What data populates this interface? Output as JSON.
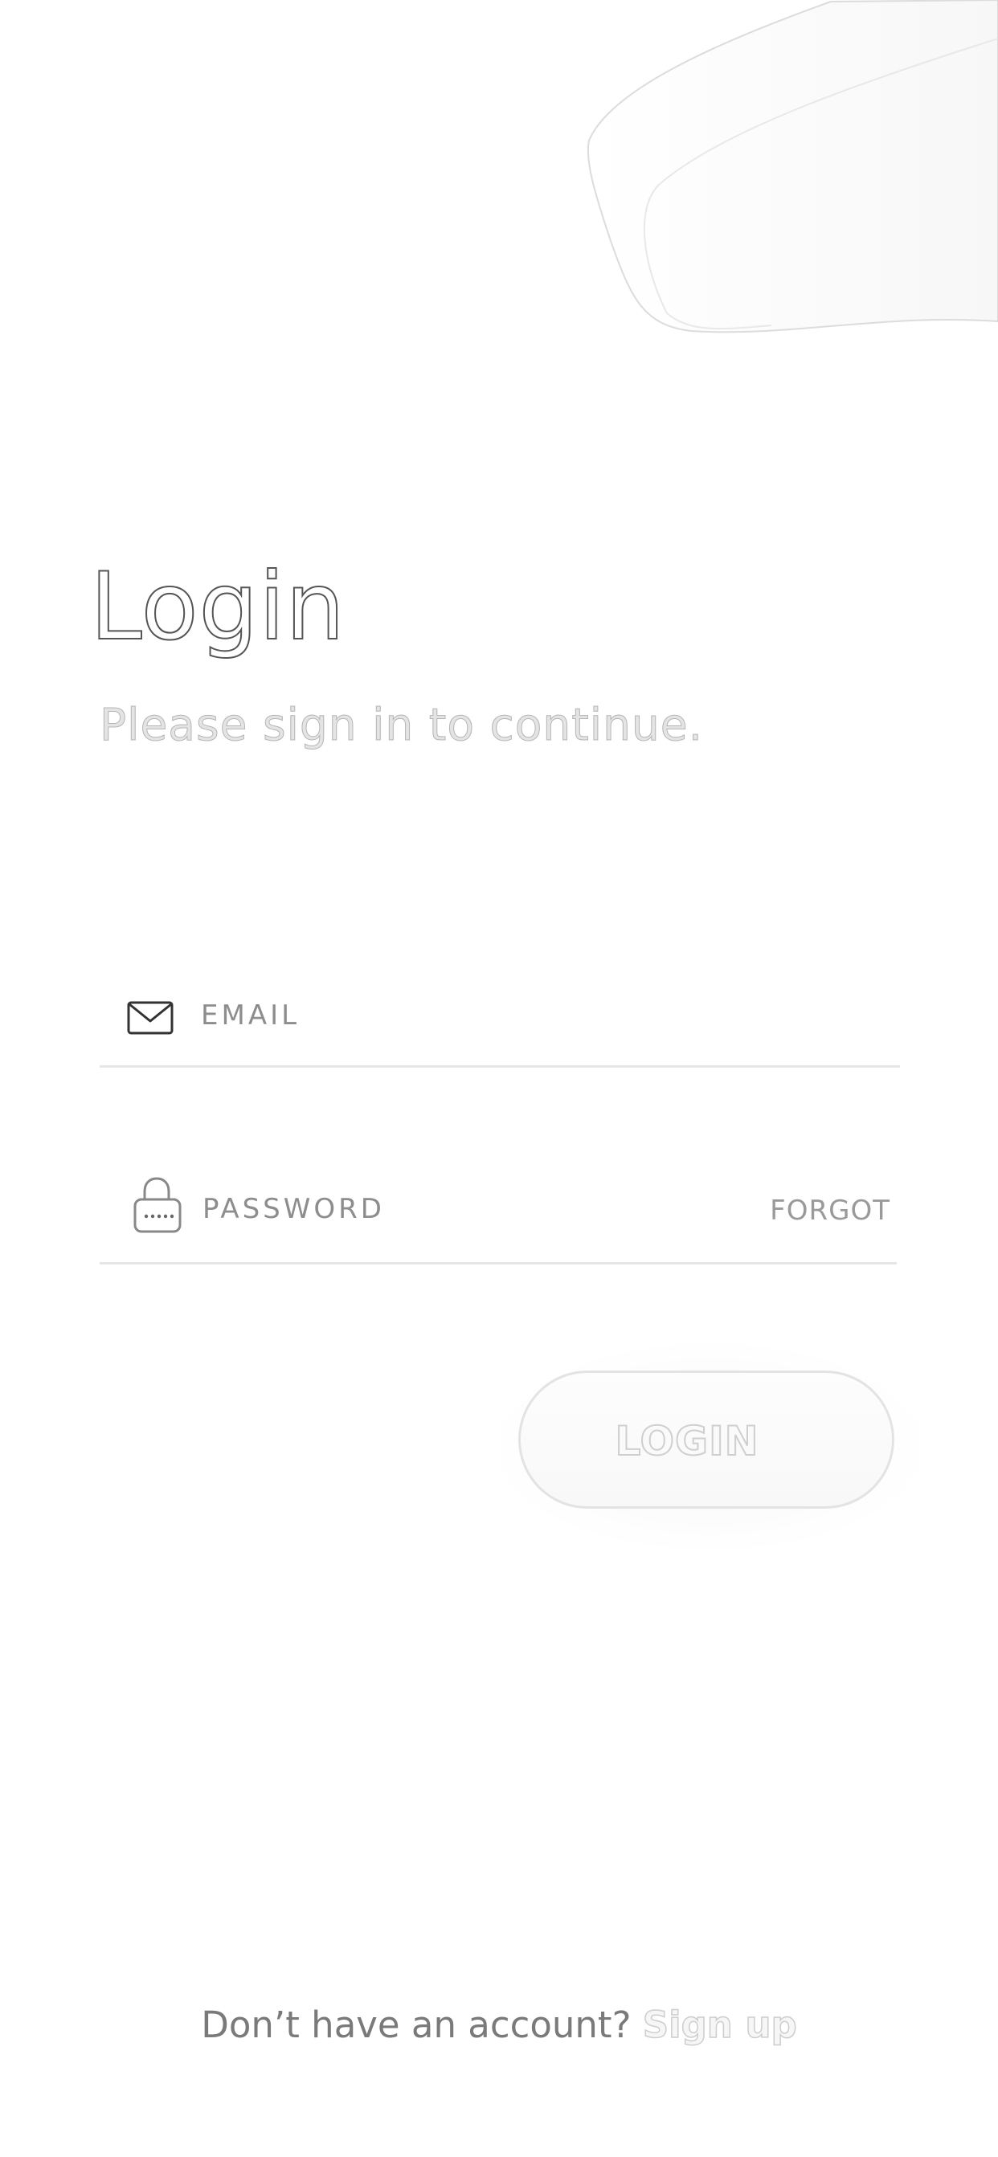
{
  "header": {
    "title": "Login",
    "subtitle": "Please sign in to continue."
  },
  "form": {
    "email": {
      "placeholder": "EMAIL",
      "icon": "envelope-icon"
    },
    "password": {
      "placeholder": "PASSWORD",
      "icon": "lock-icon",
      "forgot_label": "FORGOT"
    },
    "login_label": "LOGIN"
  },
  "footer": {
    "prompt": "Don’t have an account?",
    "signup_label": "Sign up"
  },
  "colors": {
    "background": "#ffffff",
    "text_muted": "#8d8d8d",
    "divider": "#e6e6e6"
  }
}
